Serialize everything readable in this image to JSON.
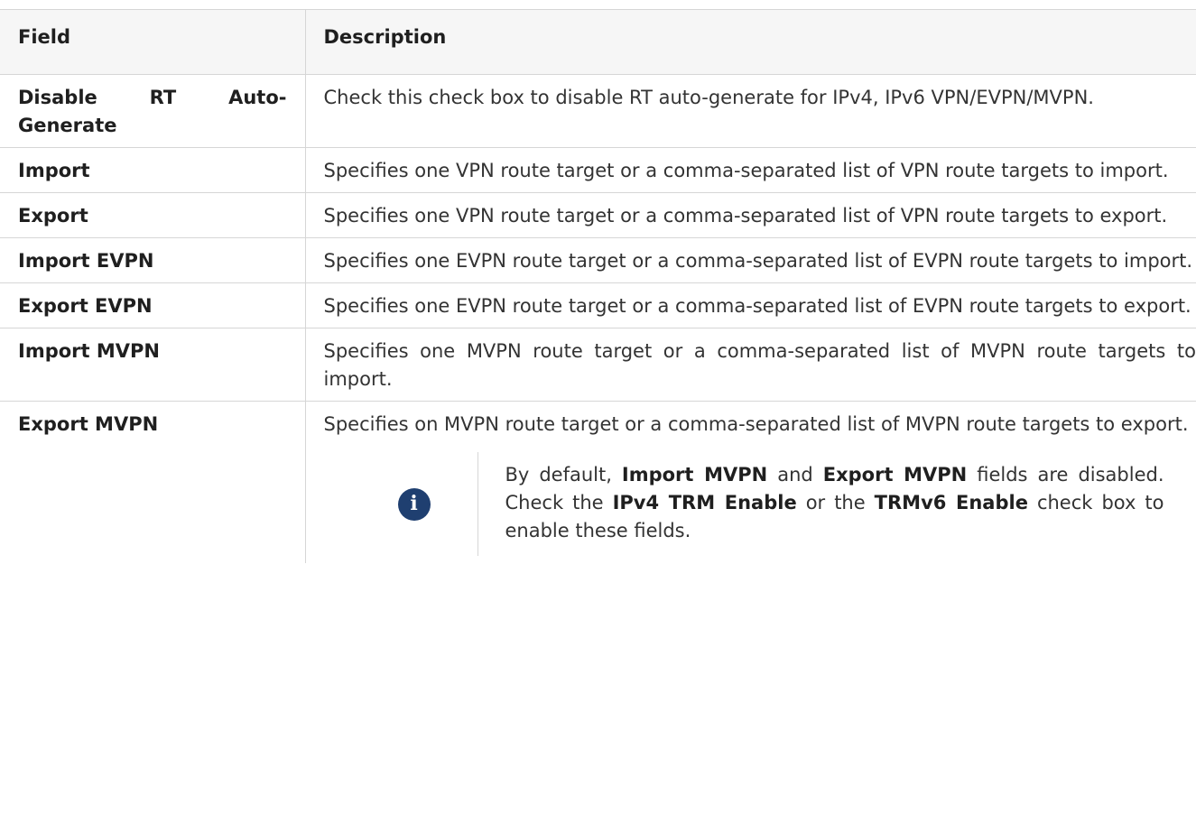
{
  "table": {
    "headers": {
      "field": "Field",
      "description": "Description"
    },
    "rows": [
      {
        "field": "Disable RT Auto-Generate",
        "description": "Check this check box to disable RT auto-generate for IPv4, IPv6 VPN/EVPN/MVPN."
      },
      {
        "field": "Import",
        "description": "Specifies one VPN route target or a comma-separated list of VPN route targets to import."
      },
      {
        "field": "Export",
        "description": "Specifies one VPN route target or a comma-separated list of VPN route targets to export."
      },
      {
        "field": "Import EVPN",
        "description": "Specifies one EVPN route target or a comma-separated list of EVPN route targets to import."
      },
      {
        "field": "Export EVPN",
        "description": "Specifies one EVPN route target or a comma-separated list of EVPN route targets to export."
      },
      {
        "field": "Import MVPN",
        "description": "Specifies one MVPN route target or a comma-separated list of MVPN route targets to import."
      },
      {
        "field": "Export MVPN",
        "description": "Specifies on MVPN route target or a comma-separated list of MVPN route targets to export."
      }
    ]
  },
  "note": {
    "icon": "info-icon",
    "icon_glyph": "i",
    "icon_color": "#1f3f70",
    "part1": "By default, ",
    "bold1": "Import MVPN",
    "part2": " and ",
    "bold2": "Export MVPN",
    "part3": " fields are disabled. Check the ",
    "bold3": "IPv4 TRM Enable",
    "part4": " or the ",
    "bold4": "TRMv6 Enable",
    "part5": " check box to enable these fields."
  }
}
